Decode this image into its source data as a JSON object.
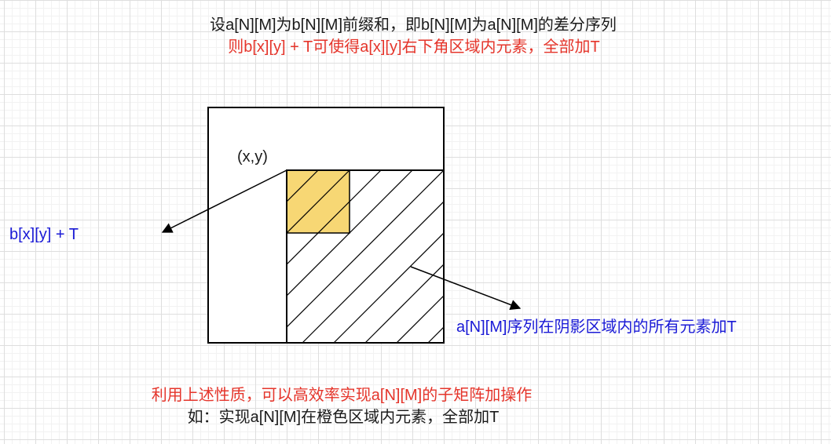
{
  "header": {
    "line1": "设a[N][M]为b[N][M]前缀和，即b[N][M]为a[N][M]的差分序列",
    "line2_prefix": "则",
    "line2_highlight": "b[x][y] + T可使得a[x][y]右下角区域内元素，全部加T"
  },
  "diagram": {
    "point_label": "(x,y)",
    "left_label": "b[x][y] + T",
    "right_label": "a[N][M]序列在阴影区域内的所有元素加T"
  },
  "footer": {
    "line1": "利用上述性质，可以高效率实现a[N][M]的子矩阵加操作",
    "line2": "如：实现a[N][M]在橙色区域内元素，全部加T"
  },
  "colors": {
    "black": "#1a1a1a",
    "red": "#e5352b",
    "blue": "#1a1ad6",
    "orange_fill": "#f7d774",
    "orange_stroke": "#c9a53a"
  }
}
